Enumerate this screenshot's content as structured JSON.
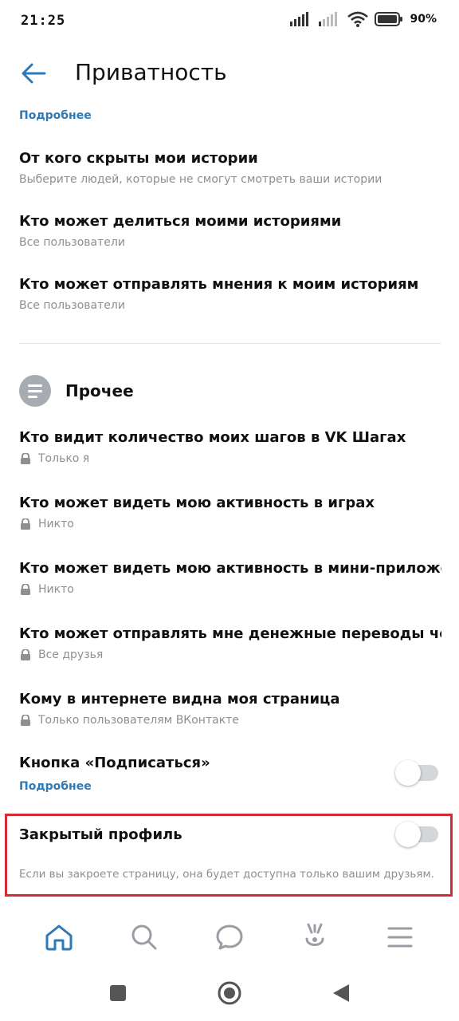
{
  "status_bar": {
    "time": "21:25",
    "battery": "90%"
  },
  "header": {
    "title": "Приватность"
  },
  "top_link": "Подробнее",
  "stories": [
    {
      "title": "От кого скрыты мои истории",
      "subtitle": "Выберите людей, которые не смогут смотреть ваши истории"
    },
    {
      "title": "Кто может делиться моими историями",
      "subtitle": "Все пользователи"
    },
    {
      "title": "Кто может отправлять мнения к моим историям",
      "subtitle": "Все пользователи"
    }
  ],
  "other_section": {
    "title": "Прочее",
    "icon": "list-icon",
    "items": [
      {
        "title": "Кто видит количество моих шагов в VK Шагах",
        "subtitle": "Только я"
      },
      {
        "title": "Кто может видеть мою активность в играх",
        "subtitle": "Никто"
      },
      {
        "title": "Кто может видеть мою активность в мини-приложениях",
        "subtitle": "Никто"
      },
      {
        "title": "Кто может отправлять мне денежные переводы через СБП",
        "subtitle": "Все друзья"
      },
      {
        "title": "Кому в интернете видна моя страница",
        "subtitle": "Только пользователям ВКонтакте"
      }
    ]
  },
  "subscribe_button": {
    "title": "Кнопка «Подписаться»",
    "link": "Подробнее",
    "enabled": false
  },
  "closed_profile": {
    "title": "Закрытый профиль",
    "description": "Если вы закроете страницу, она будет доступна только вашим друзьям.",
    "enabled": false
  },
  "colors": {
    "accent": "#2e7ab8",
    "highlight": "#d42b35",
    "secondary_text": "#8e8e93"
  },
  "tabs": [
    "home-icon",
    "search-icon",
    "messages-icon",
    "clips-icon",
    "menu-icon"
  ],
  "nav": [
    "recent-apps-icon",
    "home-circle-icon",
    "back-triangle-icon"
  ]
}
